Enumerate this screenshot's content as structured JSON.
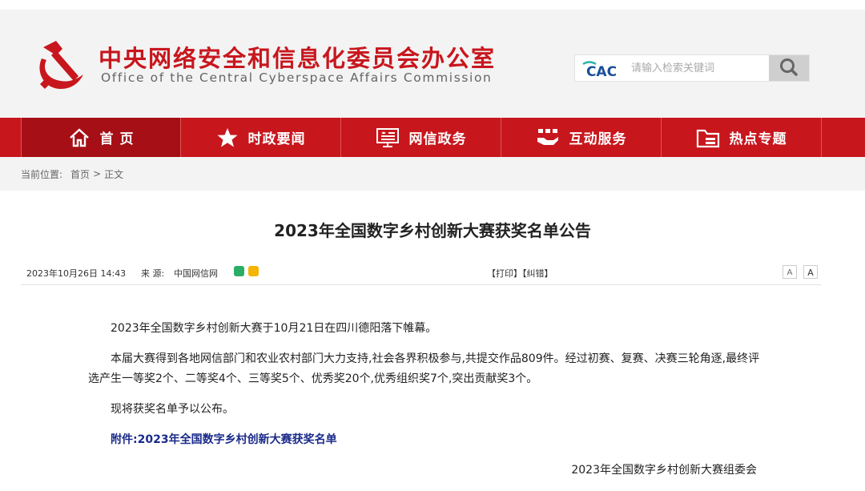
{
  "header": {
    "site_name_cn": "中央网络安全和信息化委员会办公室",
    "site_name_en": "Office of the Central Cyberspace Affairs Commission",
    "search": {
      "logo_text": "CAC",
      "placeholder": "请输入检索关键词"
    }
  },
  "nav": {
    "items": [
      {
        "label": "首 页",
        "icon": "home-icon"
      },
      {
        "label": "时政要闻",
        "icon": "star-icon"
      },
      {
        "label": "网信政务",
        "icon": "monitor-icon"
      },
      {
        "label": "互动服务",
        "icon": "handshake-icon"
      },
      {
        "label": "热点专题",
        "icon": "folder-icon"
      }
    ]
  },
  "breadcrumb": {
    "label": "当前位置:",
    "home": "首页",
    "separator": ">",
    "current": "正文"
  },
  "article": {
    "title": "2023年全国数字乡村创新大赛获奖名单公告",
    "date": "2023年10月26日 14:43",
    "source_label": "来 源:",
    "source": "中国网信网",
    "tools": "【打印】【纠错】",
    "font_small": "A",
    "font_big": "A",
    "paragraphs": [
      "2023年全国数字乡村创新大赛于10月21日在四川德阳落下帷幕。",
      "本届大赛得到各地网信部门和农业农村部门大力支持,社会各界积极参与,共提交作品809件。经过初赛、复赛、决赛三轮角逐,最终评选产生一等奖2个、二等奖4个、三等奖5个、优秀奖20个,优秀组织奖7个,突出贡献奖3个。",
      "现将获奖名单予以公布。"
    ],
    "attachment": "附件:2023年全国数字乡村创新大赛获奖名单",
    "signature": "2023年全国数字乡村创新大赛组委会"
  },
  "colors": {
    "brand_red": "#c8161d",
    "nav_active": "#a60f16",
    "attachment_blue": "#1a2a8a"
  }
}
